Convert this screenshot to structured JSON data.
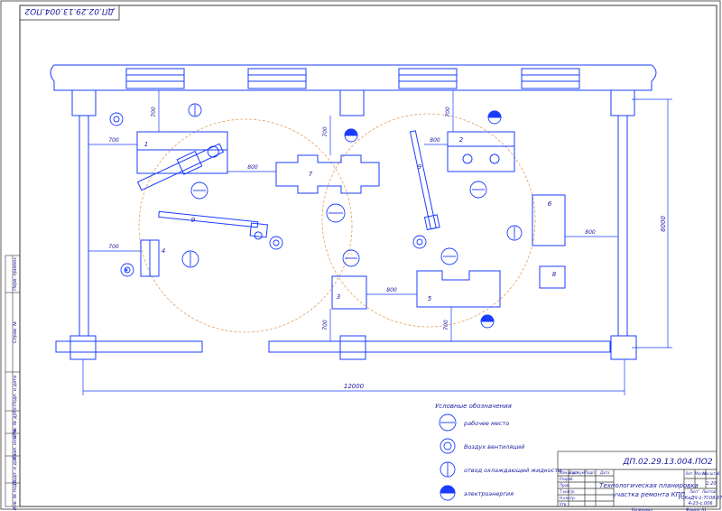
{
  "document": {
    "code_main": "ДП.02.29.13.004.ПО2",
    "code_rotated": "ДП.02.29.13.004.ПО2",
    "title_line1": "Технологическая планировка",
    "title_line2": "участка ремонта КПП",
    "sheet_info": "У.ВЛ",
    "stage_header": "Лит.",
    "mass_header": "Масса",
    "scale_header": "Масштаб",
    "scale_value": "1:20",
    "sheet_label": "Лист",
    "sheets_label": "Листов",
    "group": "УОКаДЧ-1-7С08.07",
    "year": "4-23-с.006",
    "copied": "Копировал",
    "format": "Формат А1",
    "rows": [
      "Изм. Лист",
      "Разраб.",
      "Пров.",
      "Т.контр.",
      "Н.контр.",
      "Утв."
    ],
    "cols": [
      "№ докум.",
      "Подп.",
      "Дата"
    ]
  },
  "side_stamp": [
    "Перв. примен.",
    "Справ. №",
    "Подп. и дата",
    "Инв. № дубл.",
    "Взам. инв. №",
    "Подп. и дата",
    "Инв. № подл."
  ],
  "dimensions": {
    "overall_width": "12000",
    "overall_height": "6000",
    "d700": "700",
    "d800": "800"
  },
  "equipment_labels": [
    "1",
    "2",
    "3",
    "4",
    "5",
    "6",
    "7",
    "8",
    "9",
    "9"
  ],
  "legend": {
    "title": "Условные обозначения",
    "items": [
      {
        "label": "рабочее место",
        "icon": "workplace-icon"
      },
      {
        "label": "Воздух вентиляций",
        "icon": "ventilation-icon"
      },
      {
        "label": "отвод охлаждающей жидкости",
        "icon": "coolant-drain-icon"
      },
      {
        "label": "электроэнергия",
        "icon": "power-icon"
      }
    ]
  },
  "colors": {
    "line": "#1a3cff",
    "text": "#1a1aa0",
    "crane_arc": "#e0a060"
  }
}
